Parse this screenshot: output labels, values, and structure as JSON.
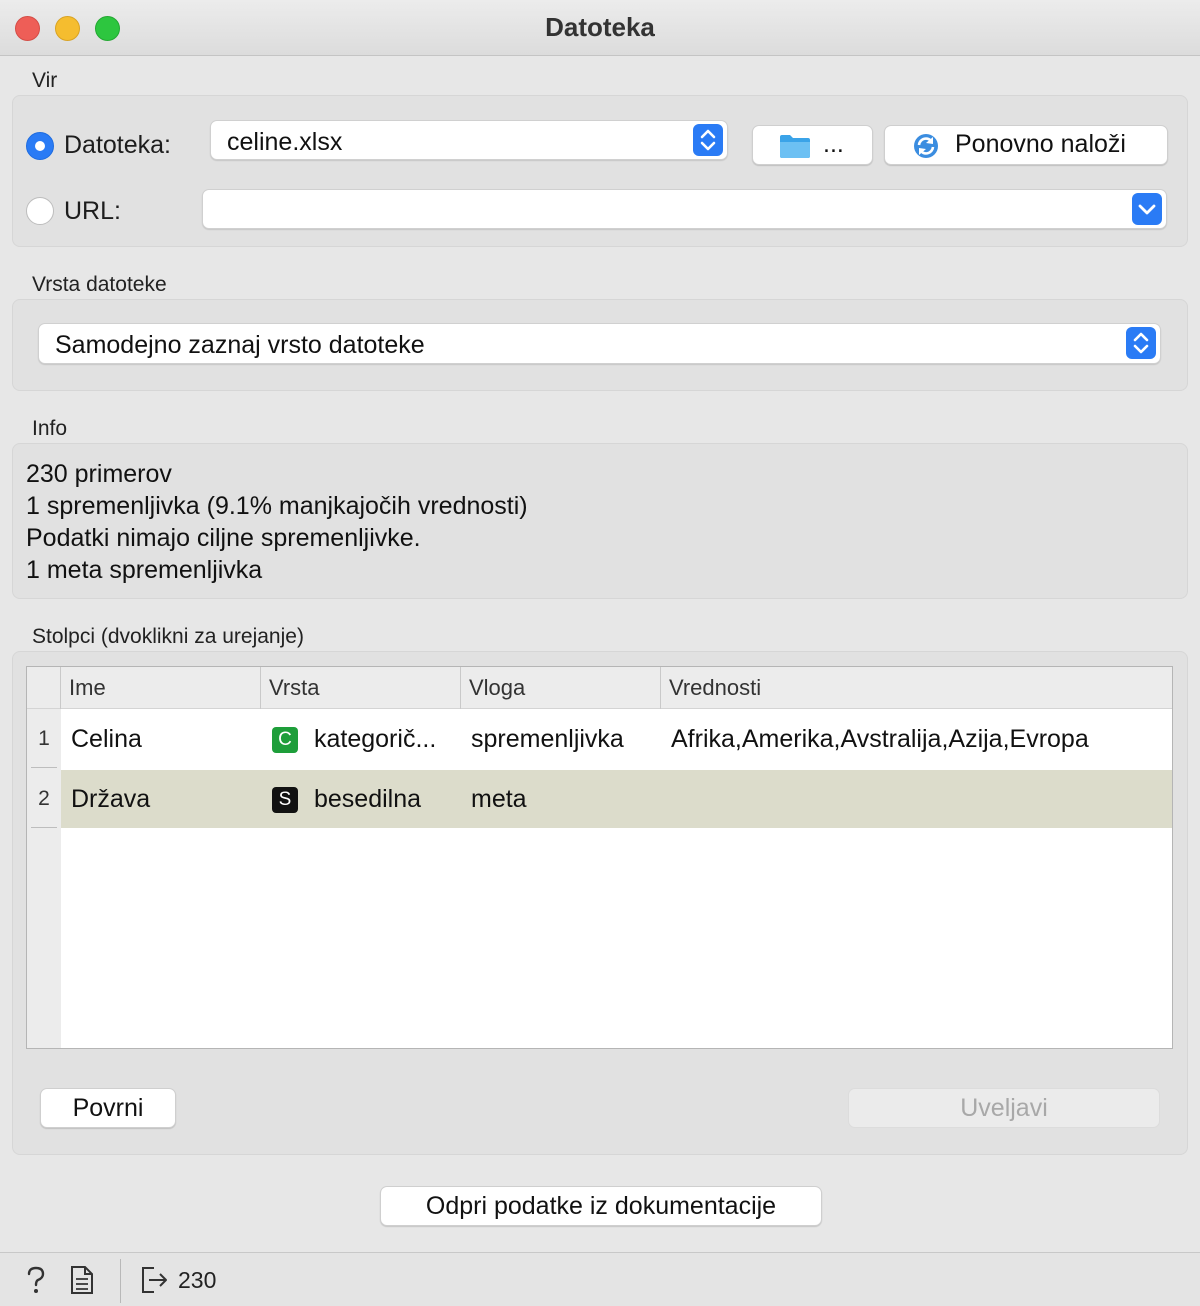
{
  "window": {
    "title": "Datoteka"
  },
  "source": {
    "label": "Vir",
    "file_radio_label": "Datoteka:",
    "file_value": "celine.xlsx",
    "browse_label": "...",
    "reload_label": "Ponovno naloži",
    "url_radio_label": "URL:",
    "url_value": "",
    "selected": "file"
  },
  "file_type": {
    "label": "Vrsta datoteke",
    "value": "Samodejno zaznaj vrsto datoteke"
  },
  "info": {
    "label": "Info",
    "lines": [
      "230 primerov",
      "1 spremenljivka (9.1% manjkajočih vrednosti)",
      "Podatki nimajo ciljne spremenljivke.",
      "1 meta spremenljivka"
    ]
  },
  "columns": {
    "label": "Stolpci (dvoklikni za urejanje)",
    "headers": [
      "Ime",
      "Vrsta",
      "Vloga",
      "Vrednosti"
    ],
    "rows": [
      {
        "num": "1",
        "name": "Celina",
        "type_badge": "C",
        "type_badge_color": "#1e9e3a",
        "type": "kategorič...",
        "role": "spremenljivka",
        "values": "Afrika,Amerika,Avstralija,Azija,Evropa"
      },
      {
        "num": "2",
        "name": "Država",
        "type_badge": "S",
        "type_badge_color": "#111111",
        "type": "besedilna",
        "role": "meta",
        "values": ""
      }
    ],
    "reset_label": "Povrni",
    "apply_label": "Uveljavi"
  },
  "doc_button_label": "Odpri podatke iz dokumentacije",
  "status": {
    "output_count": "230"
  },
  "colors": {
    "accent": "#2a7bf5",
    "selected_row": "#dcdccb"
  }
}
